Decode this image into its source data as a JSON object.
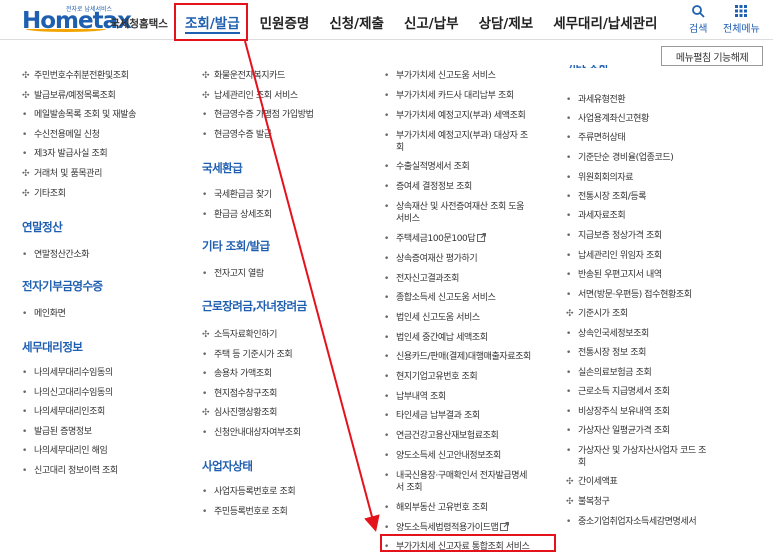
{
  "header": {
    "logo_text": "Hometax",
    "logo_small": "전자로 납세서비스",
    "logo_sub": "국세청홈택스",
    "nav": [
      "조회/발급",
      "민원증명",
      "신청/제출",
      "신고/납부",
      "상담/제보",
      "세무대리/납세관리"
    ],
    "search_label": "검색",
    "menu_label": "전체메뉴"
  },
  "menu_close_button": "메뉴펼침 기능해제",
  "col1": {
    "items_top": [
      {
        "bullet": "✣",
        "text": "주민번호수취분전환및조회"
      },
      {
        "bullet": "✣",
        "text": "발급보류/예정목록조회"
      },
      {
        "bullet": "•",
        "text": "메일발송목록 조회 및 재발송"
      },
      {
        "bullet": "•",
        "text": "수신전용메일 신청"
      },
      {
        "bullet": "•",
        "text": "제3자 발급사실 조회"
      },
      {
        "bullet": "✣",
        "text": "거래처 및 품목관리"
      },
      {
        "bullet": "✣",
        "text": "기타조회"
      }
    ],
    "cat_yearend": "연말정산",
    "items_yearend": [
      {
        "bullet": "•",
        "text": "연말정산간소화"
      }
    ],
    "cat_donation": "전자기부금영수증",
    "items_donation": [
      {
        "bullet": "•",
        "text": "메인화면"
      }
    ],
    "cat_agent": "세무대리정보",
    "items_agent": [
      {
        "bullet": "•",
        "text": "나의세무대리수임동의"
      },
      {
        "bullet": "•",
        "text": "나의신고대리수임동의"
      },
      {
        "bullet": "•",
        "text": "나의세무대리인조회"
      },
      {
        "bullet": "•",
        "text": "발급된 증명정보"
      },
      {
        "bullet": "•",
        "text": "나의세무대리인 해임"
      },
      {
        "bullet": "•",
        "text": "신고대리 정보이력 조회"
      }
    ]
  },
  "col2": {
    "items_top": [
      {
        "bullet": "✣",
        "text": "화물운전자복지카드"
      },
      {
        "bullet": "✣",
        "text": "납세관리인 조회 서비스"
      },
      {
        "bullet": "•",
        "text": "현금영수증 가맹점 가입방법"
      },
      {
        "bullet": "•",
        "text": "현금영수증 발급"
      }
    ],
    "cat_refund": "국세환급",
    "items_refund": [
      {
        "bullet": "•",
        "text": "국세환급금 찾기"
      },
      {
        "bullet": "•",
        "text": "환급금 상세조회"
      }
    ],
    "cat_etc": "기타 조회/발급",
    "items_etc": [
      {
        "bullet": "•",
        "text": "전자고지 열람"
      }
    ],
    "cat_labor": "근로장려금,자녀장려금",
    "items_labor": [
      {
        "bullet": "✣",
        "text": "소득자료확인하기"
      },
      {
        "bullet": "•",
        "text": "주택 등 기준시가 조회"
      },
      {
        "bullet": "•",
        "text": "송용차 가액조회"
      },
      {
        "bullet": "•",
        "text": "현지점수창구조회"
      },
      {
        "bullet": "✣",
        "text": "심사진행상황조회"
      },
      {
        "bullet": "•",
        "text": "신청안내대상자여부조회"
      }
    ],
    "cat_biz": "사업자상태",
    "items_biz": [
      {
        "bullet": "•",
        "text": "사업자등록번호로 조회"
      },
      {
        "bullet": "•",
        "text": "주민등록번호로 조회"
      }
    ]
  },
  "col3": {
    "items": [
      {
        "bullet": "•",
        "text": "부가가치세 신고도움 서비스"
      },
      {
        "bullet": "•",
        "text": "부가가치세 카드사 대리납부 조회"
      },
      {
        "bullet": "•",
        "text": "부가가치세 예정고지(부과) 세액조회"
      },
      {
        "bullet": "•",
        "text": "부가가치세 예정고지(부과) 대상자 조"
      },
      {
        "bullet": "",
        "text": "회"
      },
      {
        "bullet": "•",
        "text": "수출실적명세서 조회"
      },
      {
        "bullet": "•",
        "text": "증여세 결정정보 조회"
      },
      {
        "bullet": "•",
        "text": "상속재산 및 사전증여재산 조회 도움"
      },
      {
        "bullet": "",
        "text": "서비스"
      },
      {
        "bullet": "•",
        "text": "주택세금100문100답",
        "ext": true
      },
      {
        "bullet": "•",
        "text": "상속증여재산 평가하기"
      },
      {
        "bullet": "•",
        "text": "전자신고결과조회"
      },
      {
        "bullet": "•",
        "text": "종합소득세 신고도움 서비스"
      },
      {
        "bullet": "•",
        "text": "법인세 신고도움 서비스"
      },
      {
        "bullet": "•",
        "text": "법인세 중간예납 세액조회"
      },
      {
        "bullet": "•",
        "text": "신용카드/판매(결제)대행매출자료조회"
      },
      {
        "bullet": "•",
        "text": "현지기업고유번호 조회"
      },
      {
        "bullet": "•",
        "text": "납부내역 조회"
      },
      {
        "bullet": "•",
        "text": "타인세금 납부결과 조회"
      },
      {
        "bullet": "•",
        "text": "연금건강고용산재보험료조회"
      },
      {
        "bullet": "•",
        "text": "양도소득세 신고안내정보조회"
      },
      {
        "bullet": "•",
        "text": "내국신용장·구매확인서 전자발급명세"
      },
      {
        "bullet": "",
        "text": "서 조회"
      },
      {
        "bullet": "•",
        "text": "해외부동산 고유번호 조회"
      },
      {
        "bullet": "•",
        "text": "양도소득세법령적용가이드맵",
        "ext": true
      },
      {
        "bullet": "•",
        "text": "부가가치세 신고자료 통합조회 서비스"
      }
    ]
  },
  "col4": {
    "cat_partial": "기타 조회",
    "items": [
      {
        "bullet": "•",
        "text": "과세유형전환"
      },
      {
        "bullet": "•",
        "text": "사업용계좌신고현황"
      },
      {
        "bullet": "•",
        "text": "주류면허상태"
      },
      {
        "bullet": "•",
        "text": "기준단순 경비율(업종코드)"
      },
      {
        "bullet": "•",
        "text": "위원회회의자료"
      },
      {
        "bullet": "•",
        "text": "전통시장 조회/등록"
      },
      {
        "bullet": "•",
        "text": "과세자료조회"
      },
      {
        "bullet": "•",
        "text": "지급보증 정상가격 조회"
      },
      {
        "bullet": "•",
        "text": "납세관리인 위임자 조회"
      },
      {
        "bullet": "•",
        "text": "반송된 우편고지서 내역"
      },
      {
        "bullet": "•",
        "text": "서면(방문·우편등) 접수현황조회"
      },
      {
        "bullet": "✣",
        "text": "기준시가 조회"
      },
      {
        "bullet": "•",
        "text": "상속인국세정보조회"
      },
      {
        "bullet": "•",
        "text": "전통시장 정보 조회"
      },
      {
        "bullet": "•",
        "text": "실손의료보험금 조회"
      },
      {
        "bullet": "•",
        "text": "근로소득 지급명세서 조회"
      },
      {
        "bullet": "•",
        "text": "비상장주식 보유내역 조회"
      },
      {
        "bullet": "•",
        "text": "가상자산 일평균가격 조회"
      },
      {
        "bullet": "•",
        "text": "가상자산 및 가상자산사업자 코드 조"
      },
      {
        "bullet": "",
        "text": "회"
      },
      {
        "bullet": "✣",
        "text": "간이세액표"
      },
      {
        "bullet": "✣",
        "text": "불복청구"
      },
      {
        "bullet": "•",
        "text": "중소기업취업자소득세감면명세서"
      }
    ]
  },
  "colors": {
    "accent": "#1f5fb0",
    "highlight": "#e4121b"
  }
}
